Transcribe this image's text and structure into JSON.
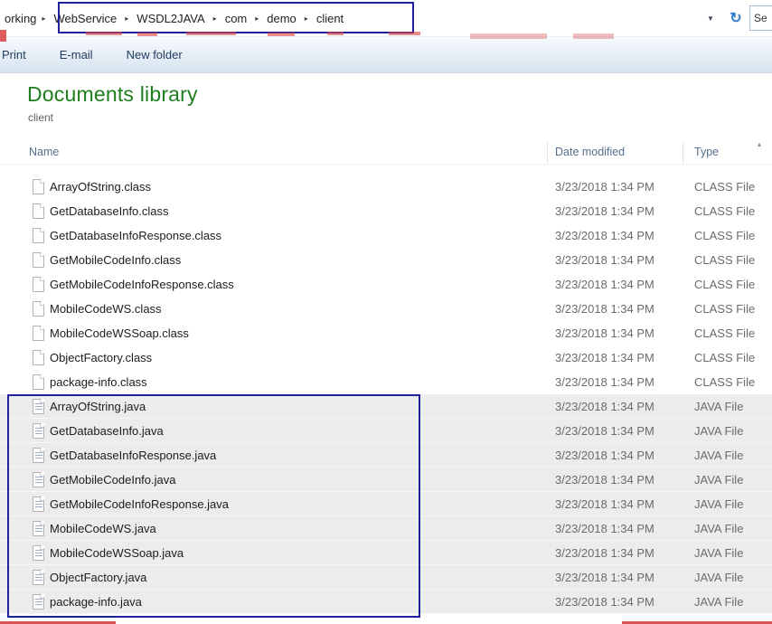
{
  "address_bar": {
    "prefix": "orking",
    "crumbs": [
      "WebService",
      "WSDL2JAVA",
      "com",
      "demo",
      "client"
    ],
    "search": {
      "value": "Se"
    }
  },
  "toolbar": {
    "items": [
      "Print",
      "E-mail",
      "New folder"
    ]
  },
  "library": {
    "title": "Documents library",
    "subtitle": "client"
  },
  "columns": [
    {
      "label": "Name"
    },
    {
      "label": "Date modified"
    },
    {
      "label": "Type"
    }
  ],
  "icons": {
    "breadcrumb_separator": "▸",
    "dropdown_arrow": "▼",
    "refresh": "↻",
    "sort_ascending": "▴"
  },
  "annotation_colors": {
    "box_blue": "#20209d",
    "mark_red": "#d84040"
  },
  "files": [
    {
      "name": "ArrayOfString.class",
      "date": "3/23/2018 1:34 PM",
      "type": "CLASS File",
      "kind": "class"
    },
    {
      "name": "GetDatabaseInfo.class",
      "date": "3/23/2018 1:34 PM",
      "type": "CLASS File",
      "kind": "class"
    },
    {
      "name": "GetDatabaseInfoResponse.class",
      "date": "3/23/2018 1:34 PM",
      "type": "CLASS File",
      "kind": "class"
    },
    {
      "name": "GetMobileCodeInfo.class",
      "date": "3/23/2018 1:34 PM",
      "type": "CLASS File",
      "kind": "class"
    },
    {
      "name": "GetMobileCodeInfoResponse.class",
      "date": "3/23/2018 1:34 PM",
      "type": "CLASS File",
      "kind": "class"
    },
    {
      "name": "MobileCodeWS.class",
      "date": "3/23/2018 1:34 PM",
      "type": "CLASS File",
      "kind": "class"
    },
    {
      "name": "MobileCodeWSSoap.class",
      "date": "3/23/2018 1:34 PM",
      "type": "CLASS File",
      "kind": "class"
    },
    {
      "name": "ObjectFactory.class",
      "date": "3/23/2018 1:34 PM",
      "type": "CLASS File",
      "kind": "class"
    },
    {
      "name": "package-info.class",
      "date": "3/23/2018 1:34 PM",
      "type": "CLASS File",
      "kind": "class"
    },
    {
      "name": "ArrayOfString.java",
      "date": "3/23/2018 1:34 PM",
      "type": "JAVA File",
      "kind": "java"
    },
    {
      "name": "GetDatabaseInfo.java",
      "date": "3/23/2018 1:34 PM",
      "type": "JAVA File",
      "kind": "java"
    },
    {
      "name": "GetDatabaseInfoResponse.java",
      "date": "3/23/2018 1:34 PM",
      "type": "JAVA File",
      "kind": "java"
    },
    {
      "name": "GetMobileCodeInfo.java",
      "date": "3/23/2018 1:34 PM",
      "type": "JAVA File",
      "kind": "java"
    },
    {
      "name": "GetMobileCodeInfoResponse.java",
      "date": "3/23/2018 1:34 PM",
      "type": "JAVA File",
      "kind": "java"
    },
    {
      "name": "MobileCodeWS.java",
      "date": "3/23/2018 1:34 PM",
      "type": "JAVA File",
      "kind": "java"
    },
    {
      "name": "MobileCodeWSSoap.java",
      "date": "3/23/2018 1:34 PM",
      "type": "JAVA File",
      "kind": "java"
    },
    {
      "name": "ObjectFactory.java",
      "date": "3/23/2018 1:34 PM",
      "type": "JAVA File",
      "kind": "java"
    },
    {
      "name": "package-info.java",
      "date": "3/23/2018 1:34 PM",
      "type": "JAVA File",
      "kind": "java"
    }
  ]
}
